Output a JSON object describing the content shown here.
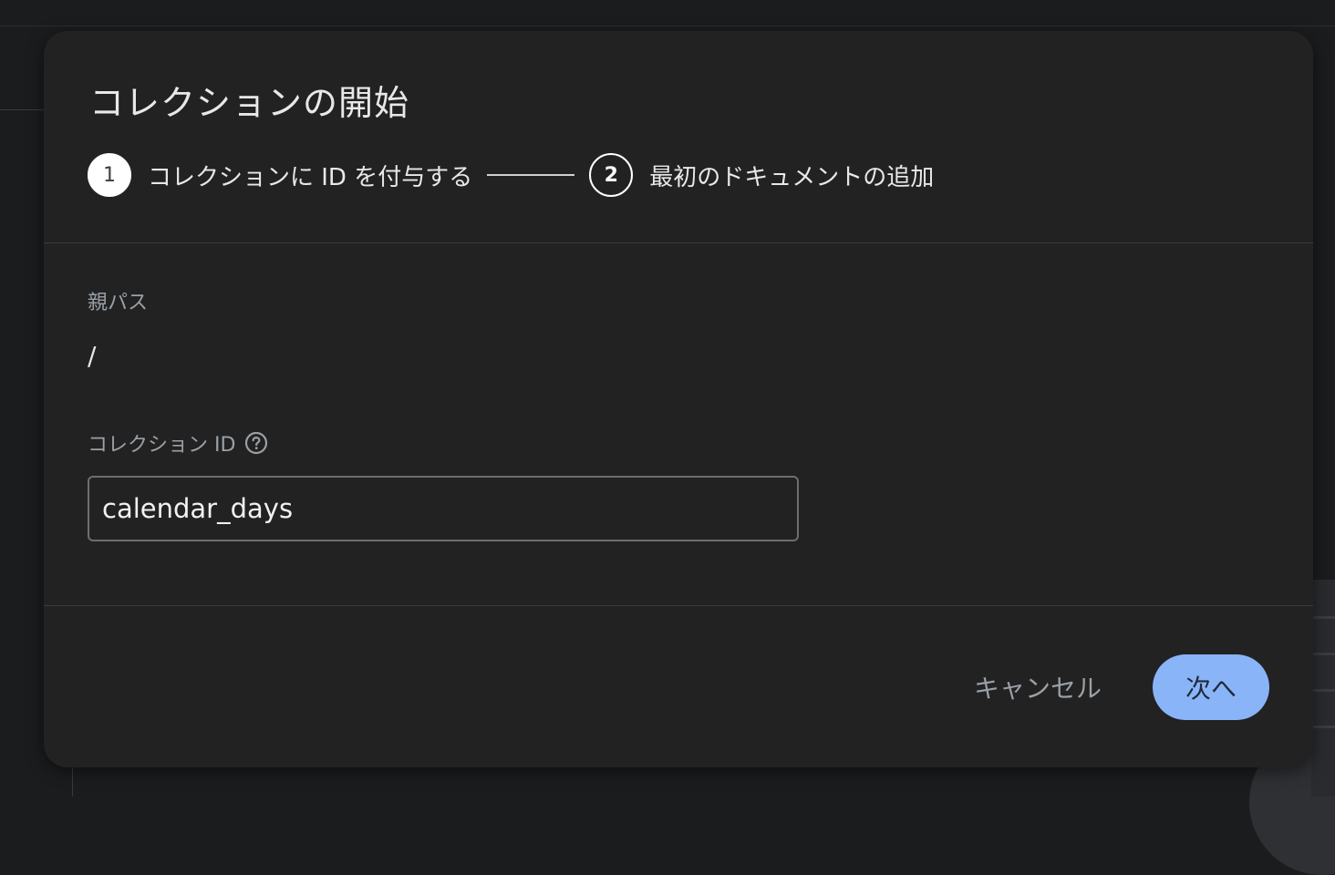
{
  "dialog": {
    "title": "コレクションの開始"
  },
  "stepper": {
    "steps": [
      {
        "number": "1",
        "label": "コレクションに ID を付与する",
        "state": "active"
      },
      {
        "number": "2",
        "label": "最初のドキュメントの追加",
        "state": "inactive"
      }
    ]
  },
  "form": {
    "parent_path_label": "親パス",
    "parent_path_value": "/",
    "collection_id_label": "コレクション ID",
    "collection_id_value": "calendar_days",
    "help_icon": "help-circle-icon"
  },
  "actions": {
    "cancel_label": "キャンセル",
    "next_label": "次へ"
  },
  "colors": {
    "dialog_bg": "#222223",
    "primary_button": "#8ab4f8",
    "muted_text": "#9aa0a6",
    "text": "#e8e8e8"
  }
}
